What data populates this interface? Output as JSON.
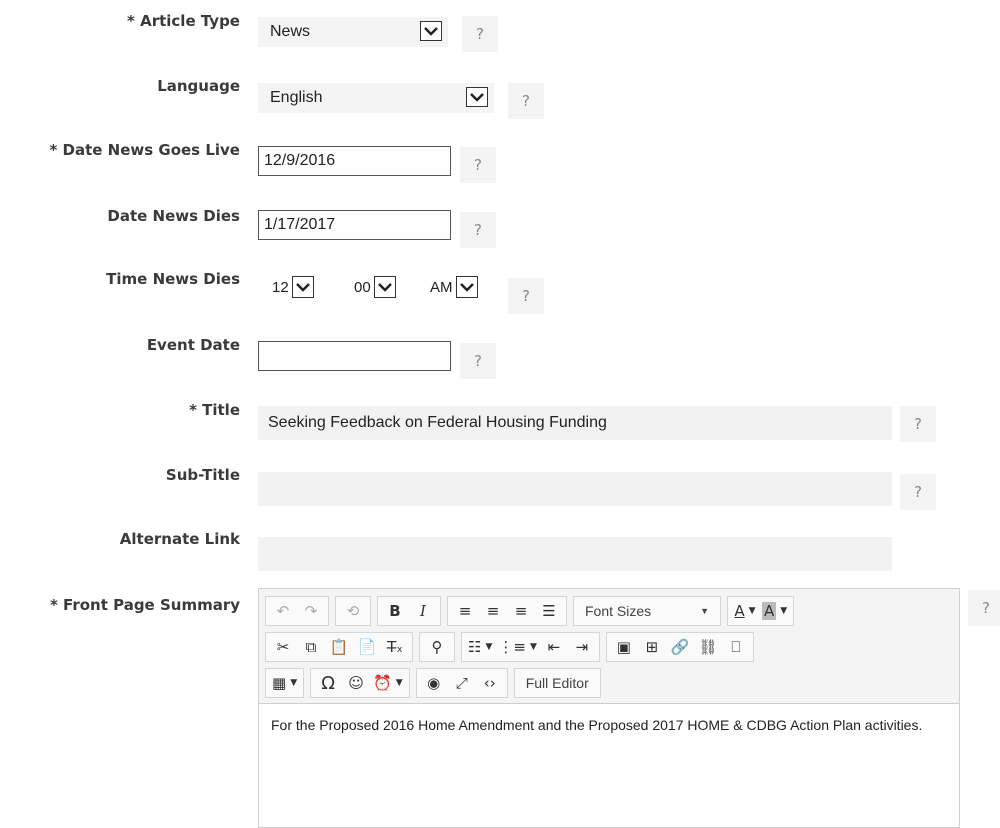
{
  "form": {
    "article_type": {
      "label": "* Article Type",
      "value": "News"
    },
    "language": {
      "label": "Language",
      "value": "English"
    },
    "date_live": {
      "label": "* Date News Goes Live",
      "value": "12/9/2016"
    },
    "date_dies": {
      "label": "Date News Dies",
      "value": "1/17/2017"
    },
    "time_dies": {
      "label": "Time News Dies",
      "hour": "12",
      "minute": "00",
      "ampm": "AM"
    },
    "event_date": {
      "label": "Event Date",
      "value": ""
    },
    "title": {
      "label": "* Title",
      "value": "Seeking Feedback on Federal Housing Funding"
    },
    "subtitle": {
      "label": "Sub-Title",
      "value": ""
    },
    "alt_link": {
      "label": "Alternate Link",
      "value": ""
    },
    "summary": {
      "label": "* Front Page Summary"
    }
  },
  "help_text": "?",
  "editor": {
    "font_sizes_label": "Font Sizes",
    "full_editor_label": "Full Editor",
    "content": "For the Proposed 2016 Home Amendment and the Proposed 2017 HOME & CDBG Action Plan activities.",
    "glyphs": {
      "undo": "↶",
      "redo": "↷",
      "history": "⟲",
      "bold": "B",
      "italic": "I",
      "align_left": "≡",
      "align_center": "≡",
      "align_right": "≡",
      "justify": "☰",
      "text_color": "A",
      "bg_color": "A",
      "caret": "▼",
      "cut": "✂",
      "copy": "⧉",
      "paste": "📋",
      "paste_word": "📄",
      "clear_format": "T̶ₓ",
      "find": "⚲",
      "bullet_list": "☷",
      "number_list": "⋮≡",
      "outdent": "⇤",
      "indent": "⇥",
      "image": "▣",
      "media": "⊞",
      "link": "🔗",
      "unlink": "⛓",
      "bookmark": "⎕",
      "table": "▦",
      "omega": "Ω",
      "emoji": "☺",
      "clock": "⏰",
      "preview": "◉",
      "fullscreen": "⤢",
      "code": "‹›"
    }
  },
  "colors": {
    "accent_text_color": "#444444",
    "highlight_bg": "#bbbbbb"
  }
}
